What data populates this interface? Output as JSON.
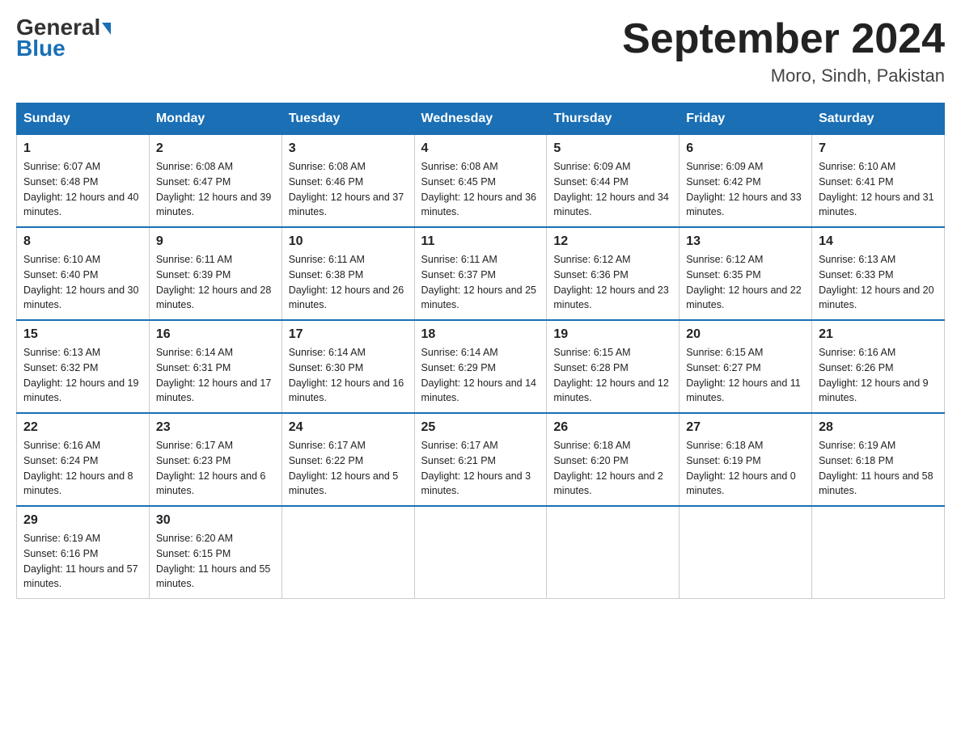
{
  "header": {
    "logo_line1": "General",
    "logo_line2": "Blue",
    "month_title": "September 2024",
    "location": "Moro, Sindh, Pakistan"
  },
  "days_of_week": [
    "Sunday",
    "Monday",
    "Tuesday",
    "Wednesday",
    "Thursday",
    "Friday",
    "Saturday"
  ],
  "weeks": [
    [
      {
        "day": "1",
        "sunrise": "Sunrise: 6:07 AM",
        "sunset": "Sunset: 6:48 PM",
        "daylight": "Daylight: 12 hours and 40 minutes."
      },
      {
        "day": "2",
        "sunrise": "Sunrise: 6:08 AM",
        "sunset": "Sunset: 6:47 PM",
        "daylight": "Daylight: 12 hours and 39 minutes."
      },
      {
        "day": "3",
        "sunrise": "Sunrise: 6:08 AM",
        "sunset": "Sunset: 6:46 PM",
        "daylight": "Daylight: 12 hours and 37 minutes."
      },
      {
        "day": "4",
        "sunrise": "Sunrise: 6:08 AM",
        "sunset": "Sunset: 6:45 PM",
        "daylight": "Daylight: 12 hours and 36 minutes."
      },
      {
        "day": "5",
        "sunrise": "Sunrise: 6:09 AM",
        "sunset": "Sunset: 6:44 PM",
        "daylight": "Daylight: 12 hours and 34 minutes."
      },
      {
        "day": "6",
        "sunrise": "Sunrise: 6:09 AM",
        "sunset": "Sunset: 6:42 PM",
        "daylight": "Daylight: 12 hours and 33 minutes."
      },
      {
        "day": "7",
        "sunrise": "Sunrise: 6:10 AM",
        "sunset": "Sunset: 6:41 PM",
        "daylight": "Daylight: 12 hours and 31 minutes."
      }
    ],
    [
      {
        "day": "8",
        "sunrise": "Sunrise: 6:10 AM",
        "sunset": "Sunset: 6:40 PM",
        "daylight": "Daylight: 12 hours and 30 minutes."
      },
      {
        "day": "9",
        "sunrise": "Sunrise: 6:11 AM",
        "sunset": "Sunset: 6:39 PM",
        "daylight": "Daylight: 12 hours and 28 minutes."
      },
      {
        "day": "10",
        "sunrise": "Sunrise: 6:11 AM",
        "sunset": "Sunset: 6:38 PM",
        "daylight": "Daylight: 12 hours and 26 minutes."
      },
      {
        "day": "11",
        "sunrise": "Sunrise: 6:11 AM",
        "sunset": "Sunset: 6:37 PM",
        "daylight": "Daylight: 12 hours and 25 minutes."
      },
      {
        "day": "12",
        "sunrise": "Sunrise: 6:12 AM",
        "sunset": "Sunset: 6:36 PM",
        "daylight": "Daylight: 12 hours and 23 minutes."
      },
      {
        "day": "13",
        "sunrise": "Sunrise: 6:12 AM",
        "sunset": "Sunset: 6:35 PM",
        "daylight": "Daylight: 12 hours and 22 minutes."
      },
      {
        "day": "14",
        "sunrise": "Sunrise: 6:13 AM",
        "sunset": "Sunset: 6:33 PM",
        "daylight": "Daylight: 12 hours and 20 minutes."
      }
    ],
    [
      {
        "day": "15",
        "sunrise": "Sunrise: 6:13 AM",
        "sunset": "Sunset: 6:32 PM",
        "daylight": "Daylight: 12 hours and 19 minutes."
      },
      {
        "day": "16",
        "sunrise": "Sunrise: 6:14 AM",
        "sunset": "Sunset: 6:31 PM",
        "daylight": "Daylight: 12 hours and 17 minutes."
      },
      {
        "day": "17",
        "sunrise": "Sunrise: 6:14 AM",
        "sunset": "Sunset: 6:30 PM",
        "daylight": "Daylight: 12 hours and 16 minutes."
      },
      {
        "day": "18",
        "sunrise": "Sunrise: 6:14 AM",
        "sunset": "Sunset: 6:29 PM",
        "daylight": "Daylight: 12 hours and 14 minutes."
      },
      {
        "day": "19",
        "sunrise": "Sunrise: 6:15 AM",
        "sunset": "Sunset: 6:28 PM",
        "daylight": "Daylight: 12 hours and 12 minutes."
      },
      {
        "day": "20",
        "sunrise": "Sunrise: 6:15 AM",
        "sunset": "Sunset: 6:27 PM",
        "daylight": "Daylight: 12 hours and 11 minutes."
      },
      {
        "day": "21",
        "sunrise": "Sunrise: 6:16 AM",
        "sunset": "Sunset: 6:26 PM",
        "daylight": "Daylight: 12 hours and 9 minutes."
      }
    ],
    [
      {
        "day": "22",
        "sunrise": "Sunrise: 6:16 AM",
        "sunset": "Sunset: 6:24 PM",
        "daylight": "Daylight: 12 hours and 8 minutes."
      },
      {
        "day": "23",
        "sunrise": "Sunrise: 6:17 AM",
        "sunset": "Sunset: 6:23 PM",
        "daylight": "Daylight: 12 hours and 6 minutes."
      },
      {
        "day": "24",
        "sunrise": "Sunrise: 6:17 AM",
        "sunset": "Sunset: 6:22 PM",
        "daylight": "Daylight: 12 hours and 5 minutes."
      },
      {
        "day": "25",
        "sunrise": "Sunrise: 6:17 AM",
        "sunset": "Sunset: 6:21 PM",
        "daylight": "Daylight: 12 hours and 3 minutes."
      },
      {
        "day": "26",
        "sunrise": "Sunrise: 6:18 AM",
        "sunset": "Sunset: 6:20 PM",
        "daylight": "Daylight: 12 hours and 2 minutes."
      },
      {
        "day": "27",
        "sunrise": "Sunrise: 6:18 AM",
        "sunset": "Sunset: 6:19 PM",
        "daylight": "Daylight: 12 hours and 0 minutes."
      },
      {
        "day": "28",
        "sunrise": "Sunrise: 6:19 AM",
        "sunset": "Sunset: 6:18 PM",
        "daylight": "Daylight: 11 hours and 58 minutes."
      }
    ],
    [
      {
        "day": "29",
        "sunrise": "Sunrise: 6:19 AM",
        "sunset": "Sunset: 6:16 PM",
        "daylight": "Daylight: 11 hours and 57 minutes."
      },
      {
        "day": "30",
        "sunrise": "Sunrise: 6:20 AM",
        "sunset": "Sunset: 6:15 PM",
        "daylight": "Daylight: 11 hours and 55 minutes."
      },
      null,
      null,
      null,
      null,
      null
    ]
  ]
}
